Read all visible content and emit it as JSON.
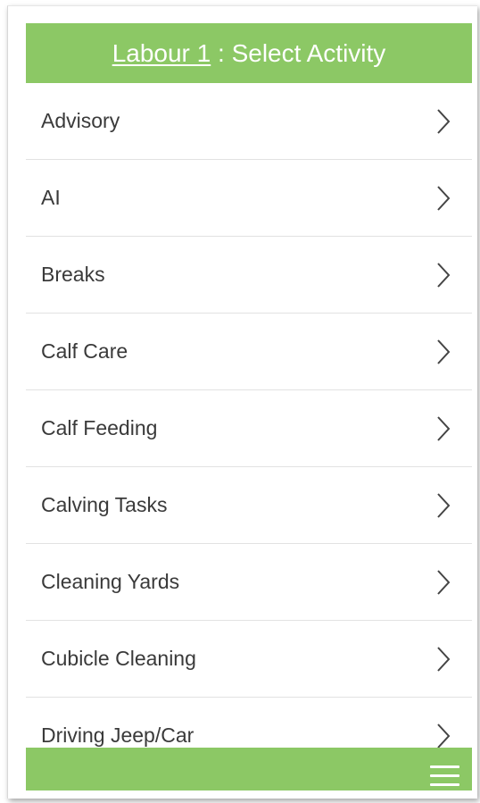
{
  "header": {
    "link_text": "Labour 1",
    "separator": " : ",
    "title": "Select Activity",
    "background_color": "#8cc865",
    "text_color": "#ffffff"
  },
  "activities": [
    {
      "label": "Advisory"
    },
    {
      "label": "AI"
    },
    {
      "label": "Breaks"
    },
    {
      "label": "Calf Care"
    },
    {
      "label": "Calf Feeding"
    },
    {
      "label": "Calving Tasks"
    },
    {
      "label": "Cleaning Yards"
    },
    {
      "label": "Cubicle Cleaning"
    },
    {
      "label": "Driving Jeep/Car"
    }
  ],
  "row_icon": "chevron-right-icon",
  "footer": {
    "menu_icon": "hamburger-menu-icon",
    "background_color": "#8cc865"
  }
}
